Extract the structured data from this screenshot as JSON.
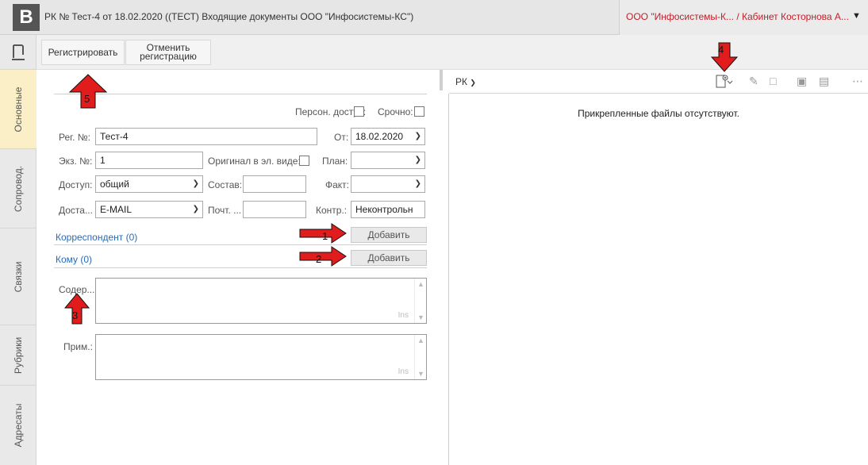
{
  "header": {
    "logo_letter": "B",
    "doc_title": "РК № Тест-4 от 18.02.2020 ((ТЕСТ) Входящие документы ООО \"Инфосистемы-КС\")",
    "org_title": "ООО \"Инфосистемы-К... / Кабинет Косторнова А..."
  },
  "vtabs": [
    "Основные",
    "Сопровод.",
    "Связки",
    "Рубрики",
    "Адресаты"
  ],
  "toolbar": {
    "register_label": "Регистрировать",
    "cancel_line1": "Отменить",
    "cancel_line2": "регистрацию"
  },
  "form": {
    "personal_access_label": "Персон. доступ:",
    "urgent_label": "Срочно:",
    "reg_no_label": "Рег. №:",
    "reg_no_value": "Тест-4",
    "date_label": "От:",
    "date_value": "18.02.2020",
    "copy_no_label": "Экз. №:",
    "copy_no_value": "1",
    "original_label": "Оригинал в эл. виде:",
    "plan_label": "План:",
    "access_label": "Доступ:",
    "access_value": "общий",
    "composition_label": "Состав:",
    "fact_label": "Факт:",
    "delivery_label": "Доста...",
    "delivery_value": "E-MAIL",
    "postal_label": "Почт. ...",
    "control_label": "Контр.:",
    "control_value": "Неконтрольн",
    "correspondent_link": "Корреспондент (0)",
    "to_link": "Кому (0)",
    "add_label": "Добавить",
    "content_label": "Содер...",
    "note_label": "Прим.:",
    "ins_label": "Ins"
  },
  "right_panel": {
    "title": "РК",
    "empty_message": "Прикрепленные файлы отсутствуют."
  },
  "annotations": [
    "1",
    "2",
    "3",
    "4",
    "5"
  ],
  "colors": {
    "accent_red": "#e01c1c",
    "active_tab": "#fbefc7",
    "link_blue": "#2a6bb5",
    "org_red": "#c0202a"
  }
}
